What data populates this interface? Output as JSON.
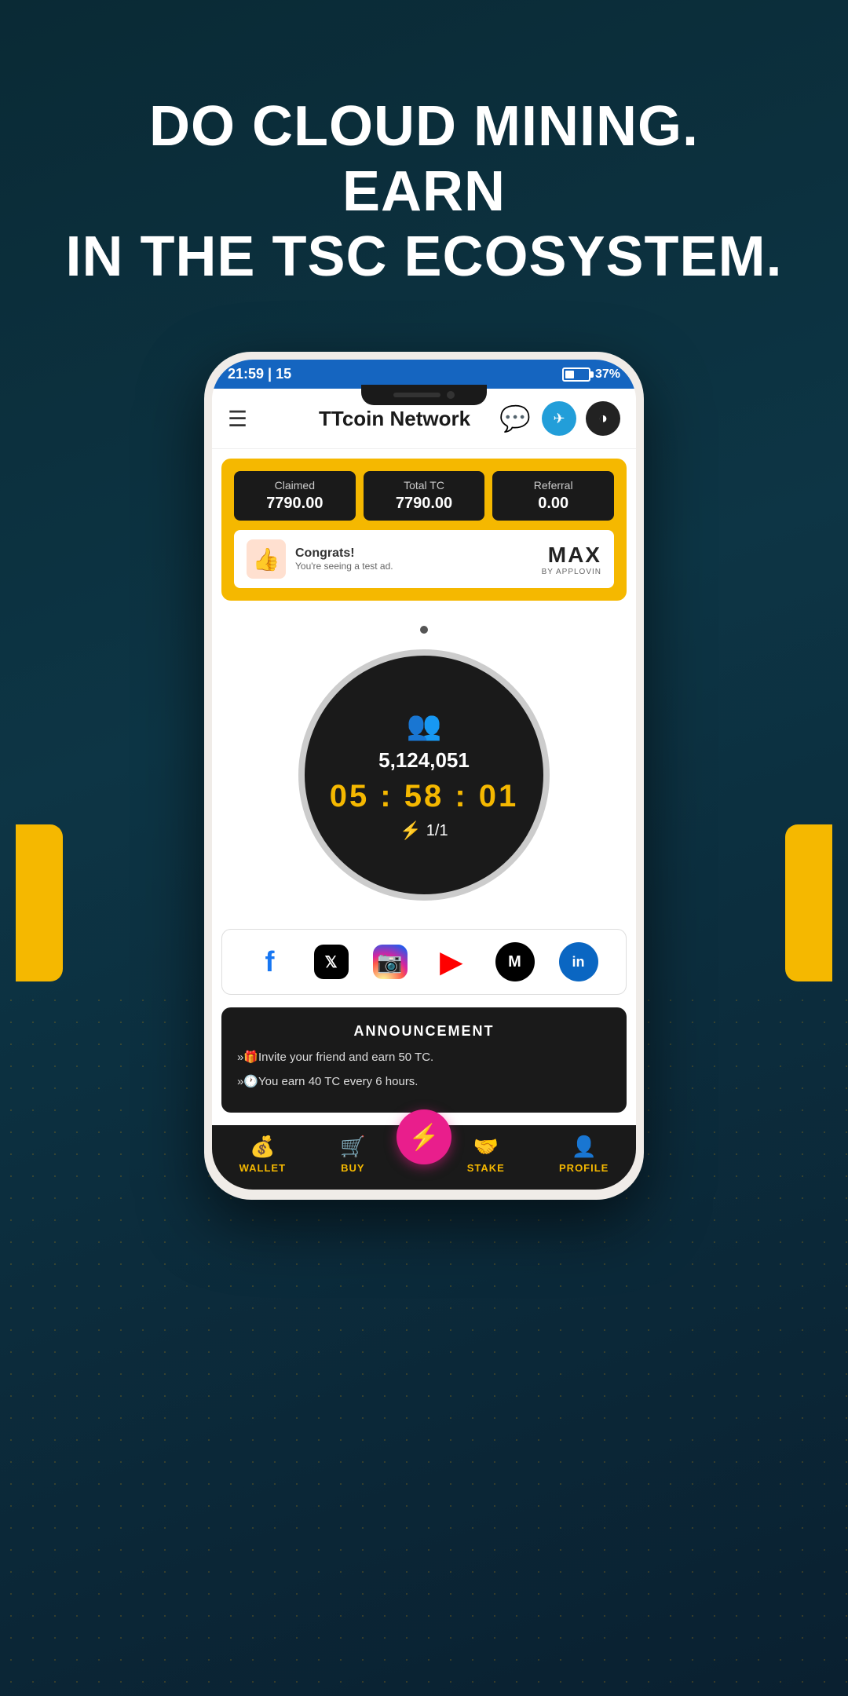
{
  "hero": {
    "line1": "DO CLOUD MINING. EARN",
    "line2": "IN THE TSC ECOSYSTEM."
  },
  "phone": {
    "statusBar": {
      "time": "21:59 | 15",
      "battery": "37%"
    },
    "header": {
      "title": "TTcoin Network"
    },
    "stats": {
      "claimed": {
        "label": "Claimed",
        "value": "7790.00"
      },
      "totalTC": {
        "label": "Total TC",
        "value": "7790.00"
      },
      "referral": {
        "label": "Referral",
        "value": "0.00"
      }
    },
    "ad": {
      "title": "Congrats!",
      "subtitle": "You're seeing a test ad.",
      "brand": "MAX",
      "brandBy": "BY APPLOVIN"
    },
    "mining": {
      "usersCount": "5,124,051",
      "timer": "05 : 58 : 01",
      "rate": "1/1"
    },
    "social": {
      "platforms": [
        "facebook",
        "twitter",
        "instagram",
        "youtube",
        "medium",
        "linkedin"
      ]
    },
    "announcement": {
      "title": "ANNOUNCEMENT",
      "items": [
        "»🎁Invite your friend and earn 50 TC.",
        "»🕐You earn 40 TC every 6 hours."
      ]
    },
    "bottomNav": {
      "items": [
        {
          "label": "WALLET",
          "icon": "💰"
        },
        {
          "label": "BUY",
          "icon": "🛒"
        },
        {
          "label": "",
          "icon": "⚡"
        },
        {
          "label": "STAKE",
          "icon": "🤝"
        },
        {
          "label": "PROFILE",
          "icon": "👤"
        }
      ]
    }
  }
}
